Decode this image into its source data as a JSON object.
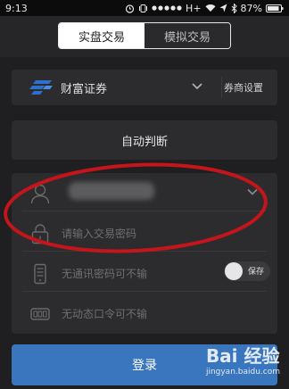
{
  "status_bar": {
    "time": "9:13",
    "network": "H+",
    "battery": "87%"
  },
  "tabs": [
    {
      "label": "实盘交易"
    },
    {
      "label": "模拟交易"
    }
  ],
  "broker": {
    "name": "财富证券",
    "settings_label": "券商设置"
  },
  "auto_button": {
    "label": "自动判断"
  },
  "form": {
    "account_placeholder": "",
    "password_placeholder": "请输入交易密码",
    "comm_password_text": "无通讯密码可不输",
    "save_toggle_label": "保存",
    "dynamic_code_text": "无动态口令可不输"
  },
  "login_button": {
    "label": "登录"
  },
  "watermark": {
    "brand": "Bai 经验",
    "url": "jingyan.baidu.com"
  },
  "colors": {
    "accent": "#3a76be",
    "annotation": "#c4151c",
    "background": "#1f1f21"
  }
}
